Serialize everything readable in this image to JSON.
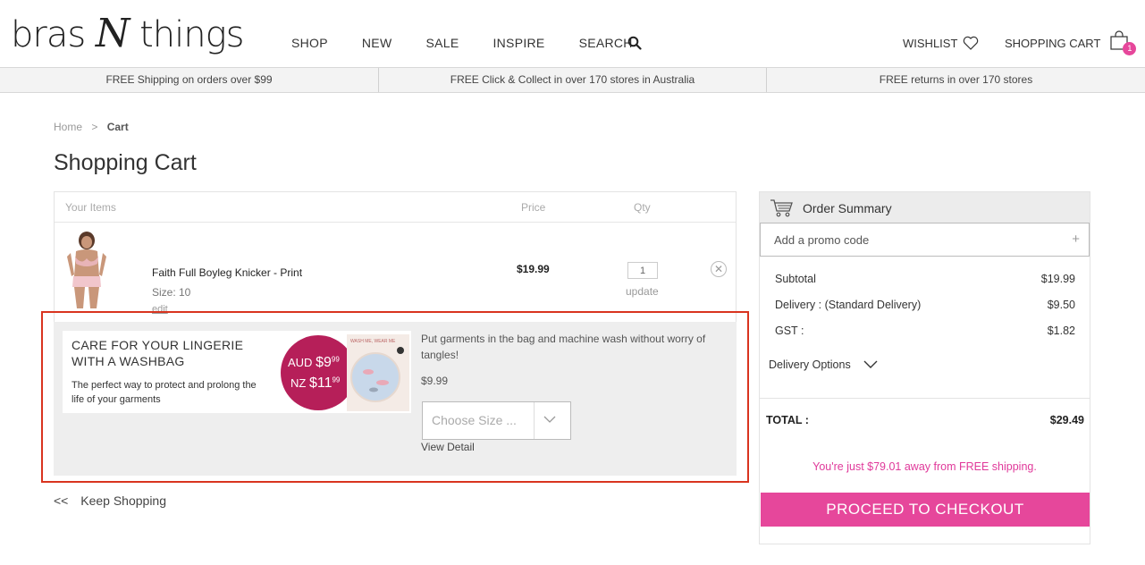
{
  "header": {
    "logo_left": "bras",
    "logo_mid": "N",
    "logo_right": "things",
    "nav": [
      "SHOP",
      "NEW",
      "SALE",
      "INSPIRE",
      "SEARCH"
    ],
    "wishlist": "WISHLIST",
    "cart": "SHOPPING CART",
    "cart_count": "1"
  },
  "promo_strip": [
    "FREE Shipping on orders over $99",
    "FREE Click & Collect in over 170 stores in Australia",
    "FREE returns in over 170 stores"
  ],
  "breadcrumb": {
    "home": "Home",
    "sep": ">",
    "current": "Cart"
  },
  "page_title": "Shopping Cart",
  "cart": {
    "headers": {
      "items": "Your Items",
      "price": "Price",
      "qty": "Qty"
    },
    "item": {
      "name": "Faith Full Boyleg Knicker - Print",
      "size": "Size: 10",
      "edit": "edit",
      "price": "$19.99",
      "qty": "1",
      "update": "update"
    }
  },
  "upsell": {
    "banner_title": "CARE FOR YOUR LINGERIE WITH A WASHBAG",
    "banner_sub": "The perfect way to protect and prolong the life of your garments",
    "aud_label": "AUD",
    "aud_price": "$9",
    "aud_cents": "99",
    "nz_label": "NZ",
    "nz_price": "$11",
    "nz_cents": "99",
    "bag_text": "WASH ME, WEAR ME",
    "description": "Put garments in the bag and machine wash without worry of tangles!",
    "price": "$9.99",
    "size_placeholder": "Choose Size ...",
    "view_detail": "View Detail"
  },
  "keep_shopping": {
    "arrows": "<<",
    "label": "Keep Shopping"
  },
  "summary": {
    "title": "Order Summary",
    "promo": "Add a promo code",
    "promo_plus": "+",
    "subtotal_label": "Subtotal",
    "subtotal": "$19.99",
    "delivery_label": "Delivery : (Standard Delivery)",
    "delivery": "$9.50",
    "gst_label": "GST :",
    "gst": "$1.82",
    "delivery_options": "Delivery Options",
    "total_label": "TOTAL :",
    "total": "$29.49",
    "free_shipping": "You're just $79.01 away from FREE shipping.",
    "checkout": "PROCEED TO CHECKOUT"
  },
  "colors": {
    "brand_pink": "#e6479b",
    "promo_red_outline": "#d9341f",
    "price_circle": "#b61f59"
  }
}
